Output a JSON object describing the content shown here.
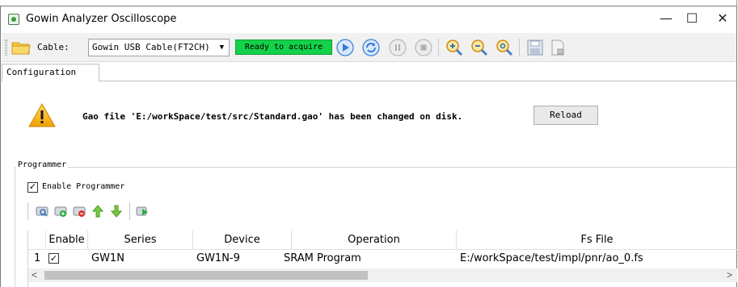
{
  "window": {
    "title": "Gowin Analyzer Oscilloscope",
    "minimize_glyph": "—",
    "maximize_glyph": "☐",
    "close_glyph": "✕"
  },
  "toolbar": {
    "cable_label": "Cable:",
    "cable_value": "Gowin USB Cable(FT2CH)",
    "status": "Ready to acquire",
    "status_color": "#14d14a",
    "buttons": [
      "start-icon",
      "loop-icon",
      "pause-icon",
      "stop-icon",
      "zoom-in-icon",
      "zoom-out-icon",
      "zoom-fit-icon",
      "save-icon",
      "export-icon"
    ]
  },
  "tabs": [
    {
      "label": "Configuration"
    }
  ],
  "notice": {
    "message": "Gao file 'E:/workSpace/test/src/Standard.gao' has been changed on disk.",
    "reload_label": "Reload"
  },
  "programmer": {
    "group_title": "Programmer",
    "enable_label": "Enable Programmer",
    "enable_checked": true,
    "toolbar_icons": [
      "scan-icon",
      "add-icon",
      "remove-icon",
      "move-up-icon",
      "move-down-icon",
      "program-icon"
    ],
    "table": {
      "columns": [
        "Enable",
        "Series",
        "Device",
        "Operation",
        "Fs File"
      ],
      "rows": [
        {
          "index": "1",
          "enabled": true,
          "series": "GW1N",
          "device": "GW1N-9",
          "operation": "SRAM Program",
          "fs_file": "E:/workSpace/test/impl/pnr/ao_0.fs"
        }
      ]
    }
  },
  "scrollbar": {
    "left_arrow": "<",
    "right_arrow": ">"
  }
}
